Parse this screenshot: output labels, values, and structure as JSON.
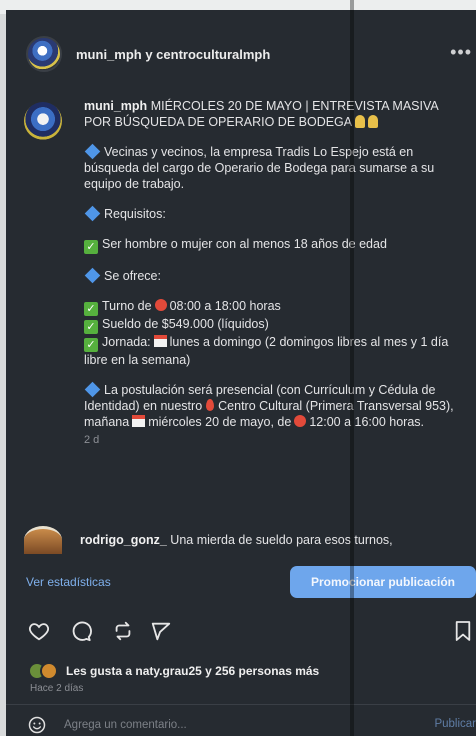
{
  "header": {
    "username": "muni_mph y centroculturalmph",
    "more_icon": "ellipsis-icon"
  },
  "caption": {
    "author": "muni_mph",
    "headline": "MIÉRCOLES 20 DE MAYO | ENTREVISTA MASIVA POR BÚSQUEDA DE OPERARIO DE BODEGA",
    "intro": "Vecinas y vecinos, la empresa Tradis Lo Espejo está en búsqueda del cargo de Operario de Bodega para sumarse a su equipo de trabajo.",
    "requisitos_label": "Requisitos:",
    "requisito_1": "Ser hombre o mujer con al menos 18 años de edad",
    "ofrece_label": "Se ofrece:",
    "turno_prefix": "Turno de",
    "turno_value": "08:00 a 18:00 horas",
    "sueldo": "Sueldo de $549.000 (líquidos)",
    "jornada_prefix": "Jornada:",
    "jornada_value": "lunes a domingo (2 domingos libres al mes y 1 día libre en la semana)",
    "postulacion_1": "La postulación será presencial (con Currículum y Cédula de Identidad) en nuestro",
    "postulacion_place": "Centro Cultural (Primera Transversal 953), mañana",
    "postulacion_date": "miércoles 20 de mayo, de",
    "postulacion_time": "12:00 a 16:00 horas.",
    "time_ago": "2 d"
  },
  "comment": {
    "author": "rodrigo_gonz_",
    "text": "Una mierda de sueldo para esos turnos,"
  },
  "stats": {
    "link": "Ver estadísticas",
    "promote": "Promocionar publicación"
  },
  "actions": {
    "like": "heart-icon",
    "comment": "comment-icon",
    "share": "repost-icon",
    "send": "send-icon",
    "save": "bookmark-icon"
  },
  "likes": {
    "text": "Les gusta a naty.grau25 y 256 personas más",
    "date": "Hace 2 días"
  },
  "comment_box": {
    "placeholder": "Agrega un comentario...",
    "publish": "Publicar"
  }
}
